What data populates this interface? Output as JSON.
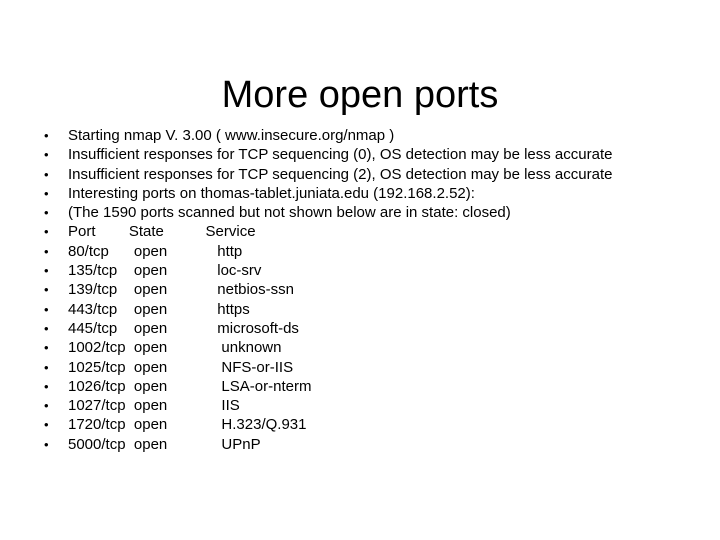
{
  "slide": {
    "title": "More open ports",
    "bullet_marker": "•",
    "lines": [
      {
        "text": "Starting nmap V. 3.00 ( www.insecure.org/nmap )"
      },
      {
        "text": "Insufficient responses for TCP sequencing (0), OS detection may be less accurate"
      },
      {
        "text": "Insufficient responses for TCP sequencing (2), OS detection may be less accurate"
      },
      {
        "text": "Interesting ports on thomas-tablet.juniata.edu (192.168.2.52):"
      },
      {
        "text": "(The 1590 ports scanned but not shown below are in state: closed)"
      },
      {
        "text": "Port        State          Service"
      },
      {
        "text": "80/tcp      open            http"
      },
      {
        "text": "135/tcp    open            loc-srv"
      },
      {
        "text": "139/tcp    open            netbios-ssn"
      },
      {
        "text": "443/tcp    open            https"
      },
      {
        "text": "445/tcp    open            microsoft-ds"
      },
      {
        "text": "1002/tcp  open             unknown"
      },
      {
        "text": "1025/tcp  open             NFS-or-IIS"
      },
      {
        "text": "1026/tcp  open             LSA-or-nterm"
      },
      {
        "text": "1027/tcp  open             IIS"
      },
      {
        "text": "1720/tcp  open             H.323/Q.931"
      },
      {
        "text": "5000/tcp  open             UPnP"
      }
    ],
    "scan_report": {
      "tool": "nmap",
      "version": "V. 3.00",
      "source_url": "www.insecure.org/nmap",
      "host": "thomas-tablet.juniata.edu",
      "ip": "192.168.2.52",
      "closed_ports_note": "(The 1590 ports scanned but not shown below are in state: closed)",
      "closed_ports_count": 1590,
      "warnings": [
        "Insufficient responses for TCP sequencing (0), OS detection may be less accurate",
        "Insufficient responses for TCP sequencing (2), OS detection may be less accurate"
      ],
      "columns": [
        "Port",
        "State",
        "Service"
      ],
      "rows": [
        {
          "port": "80/tcp",
          "state": "open",
          "service": "http"
        },
        {
          "port": "135/tcp",
          "state": "open",
          "service": "loc-srv"
        },
        {
          "port": "139/tcp",
          "state": "open",
          "service": "netbios-ssn"
        },
        {
          "port": "443/tcp",
          "state": "open",
          "service": "https"
        },
        {
          "port": "445/tcp",
          "state": "open",
          "service": "microsoft-ds"
        },
        {
          "port": "1002/tcp",
          "state": "open",
          "service": "unknown"
        },
        {
          "port": "1025/tcp",
          "state": "open",
          "service": "NFS-or-IIS"
        },
        {
          "port": "1026/tcp",
          "state": "open",
          "service": "LSA-or-nterm"
        },
        {
          "port": "1027/tcp",
          "state": "open",
          "service": "IIS"
        },
        {
          "port": "1720/tcp",
          "state": "open",
          "service": "H.323/Q.931"
        },
        {
          "port": "5000/tcp",
          "state": "open",
          "service": "UPnP"
        }
      ]
    }
  },
  "colors": {
    "background": "#ffffff",
    "text": "#000000"
  }
}
